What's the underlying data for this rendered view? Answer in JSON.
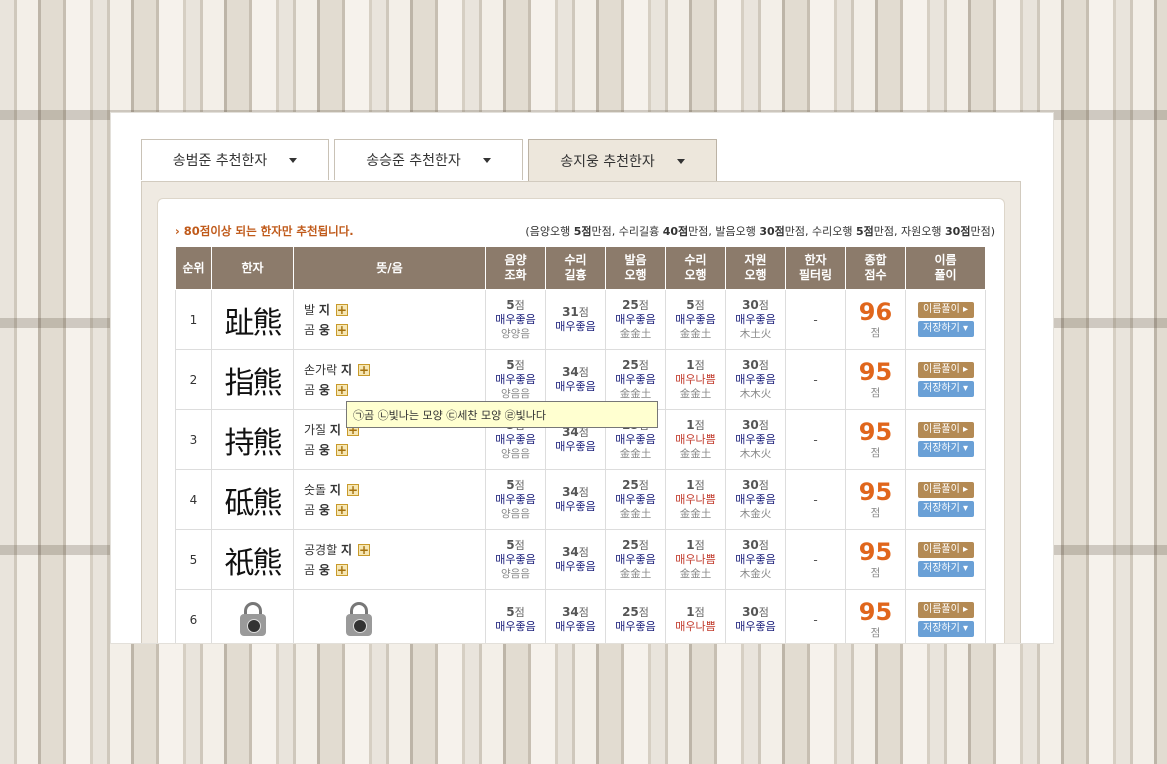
{
  "tabs": [
    {
      "label": "송범준 추천한자"
    },
    {
      "label": "송승준 추천한자"
    },
    {
      "label": "송지웅 추천한자"
    }
  ],
  "note": {
    "left": "80점이상 되는 한자만 추천됩니다.",
    "right_parts": [
      "(음양오행 ",
      "5점",
      "만점, 수리길흉 ",
      "40점",
      "만점, 발음오행 ",
      "30점",
      "만점, 수리오행 ",
      "5점",
      "만점, 자원오행 ",
      "30점",
      "만점)"
    ]
  },
  "headers": [
    "순위",
    "한자",
    "뜻/음",
    "음양\n조화",
    "수리\n길흉",
    "발음\n오행",
    "수리\n오행",
    "자원\n오행",
    "한자\n필터링",
    "종합\n점수",
    "이름\n풀이"
  ],
  "labels": {
    "point_unit": "점",
    "btn_name": "이름풀이 ▸",
    "btn_save": "저장하기 ▾"
  },
  "rows": [
    {
      "rank": "1",
      "hanja": "趾熊",
      "m1": "발",
      "s1": "지",
      "m2": "곰",
      "s2": "웅",
      "eumyang": {
        "pt": "5",
        "g": "매우좋음",
        "s": "양양음"
      },
      "suri": {
        "pt": "31",
        "g": "매우좋음"
      },
      "baleum": {
        "pt": "25",
        "g": "매우좋음",
        "s": "金金土"
      },
      "surio": {
        "pt": "5",
        "g": "매우좋음",
        "s": "金金土",
        "bad": false
      },
      "jawon": {
        "pt": "30",
        "g": "매우좋음",
        "s": "木土火"
      },
      "filter": "-",
      "total": "96"
    },
    {
      "rank": "2",
      "hanja": "指熊",
      "m1": "손가락",
      "s1": "지",
      "m2": "곰",
      "s2": "웅",
      "eumyang": {
        "pt": "5",
        "g": "매우좋음",
        "s": "양음음"
      },
      "suri": {
        "pt": "34",
        "g": "매우좋음"
      },
      "baleum": {
        "pt": "25",
        "g": "매우좋음",
        "s": "金金土"
      },
      "surio": {
        "pt": "1",
        "g": "매우나쁨",
        "s": "金金土",
        "bad": true
      },
      "jawon": {
        "pt": "30",
        "g": "매우좋음",
        "s": "木木火"
      },
      "filter": "-",
      "total": "95"
    },
    {
      "rank": "3",
      "hanja": "持熊",
      "m1": "가질",
      "s1": "지",
      "m2": "곰",
      "s2": "웅",
      "eumyang": {
        "pt": "5",
        "g": "매우좋음",
        "s": "양음음"
      },
      "suri": {
        "pt": "34",
        "g": "매우좋음"
      },
      "baleum": {
        "pt": "25",
        "g": "매우좋음",
        "s": "金金土"
      },
      "surio": {
        "pt": "1",
        "g": "매우나쁨",
        "s": "金金土",
        "bad": true
      },
      "jawon": {
        "pt": "30",
        "g": "매우좋음",
        "s": "木木火"
      },
      "filter": "-",
      "total": "95"
    },
    {
      "rank": "4",
      "hanja": "砥熊",
      "m1": "숫돌",
      "s1": "지",
      "m2": "곰",
      "s2": "웅",
      "eumyang": {
        "pt": "5",
        "g": "매우좋음",
        "s": "양음음"
      },
      "suri": {
        "pt": "34",
        "g": "매우좋음"
      },
      "baleum": {
        "pt": "25",
        "g": "매우좋음",
        "s": "金金土"
      },
      "surio": {
        "pt": "1",
        "g": "매우나쁨",
        "s": "金金土",
        "bad": true
      },
      "jawon": {
        "pt": "30",
        "g": "매우좋음",
        "s": "木金火"
      },
      "filter": "-",
      "total": "95"
    },
    {
      "rank": "5",
      "hanja": "祇熊",
      "m1": "공경할",
      "s1": "지",
      "m2": "곰",
      "s2": "웅",
      "eumyang": {
        "pt": "5",
        "g": "매우좋음",
        "s": "양음음"
      },
      "suri": {
        "pt": "34",
        "g": "매우좋음"
      },
      "baleum": {
        "pt": "25",
        "g": "매우좋음",
        "s": "金金土"
      },
      "surio": {
        "pt": "1",
        "g": "매우나쁨",
        "s": "金金土",
        "bad": true
      },
      "jawon": {
        "pt": "30",
        "g": "매우좋음",
        "s": "木金火"
      },
      "filter": "-",
      "total": "95"
    },
    {
      "rank": "6",
      "hanja": "",
      "m1": "",
      "s1": "",
      "m2": "",
      "s2": "",
      "eumyang": {
        "pt": "5",
        "g": "매우좋음",
        "s": ""
      },
      "suri": {
        "pt": "34",
        "g": "매우좋음"
      },
      "baleum": {
        "pt": "25",
        "g": "매우좋음",
        "s": ""
      },
      "surio": {
        "pt": "1",
        "g": "매우나쁨",
        "s": "",
        "bad": true
      },
      "jawon": {
        "pt": "30",
        "g": "매우좋음",
        "s": ""
      },
      "filter": "-",
      "total": "95"
    }
  ],
  "tooltip": "㉠곰 ㉡빛나는 모양 ㉢세찬 모양 ㉣빛나다",
  "icons": {
    "plus": "plus-icon",
    "caret": "caret-down-icon",
    "lock": "padlock-icon"
  },
  "colors": {
    "header": "#8c7b6b",
    "accent": "#e0661c",
    "good": "#1a1e7a",
    "bad": "#c0392b"
  }
}
